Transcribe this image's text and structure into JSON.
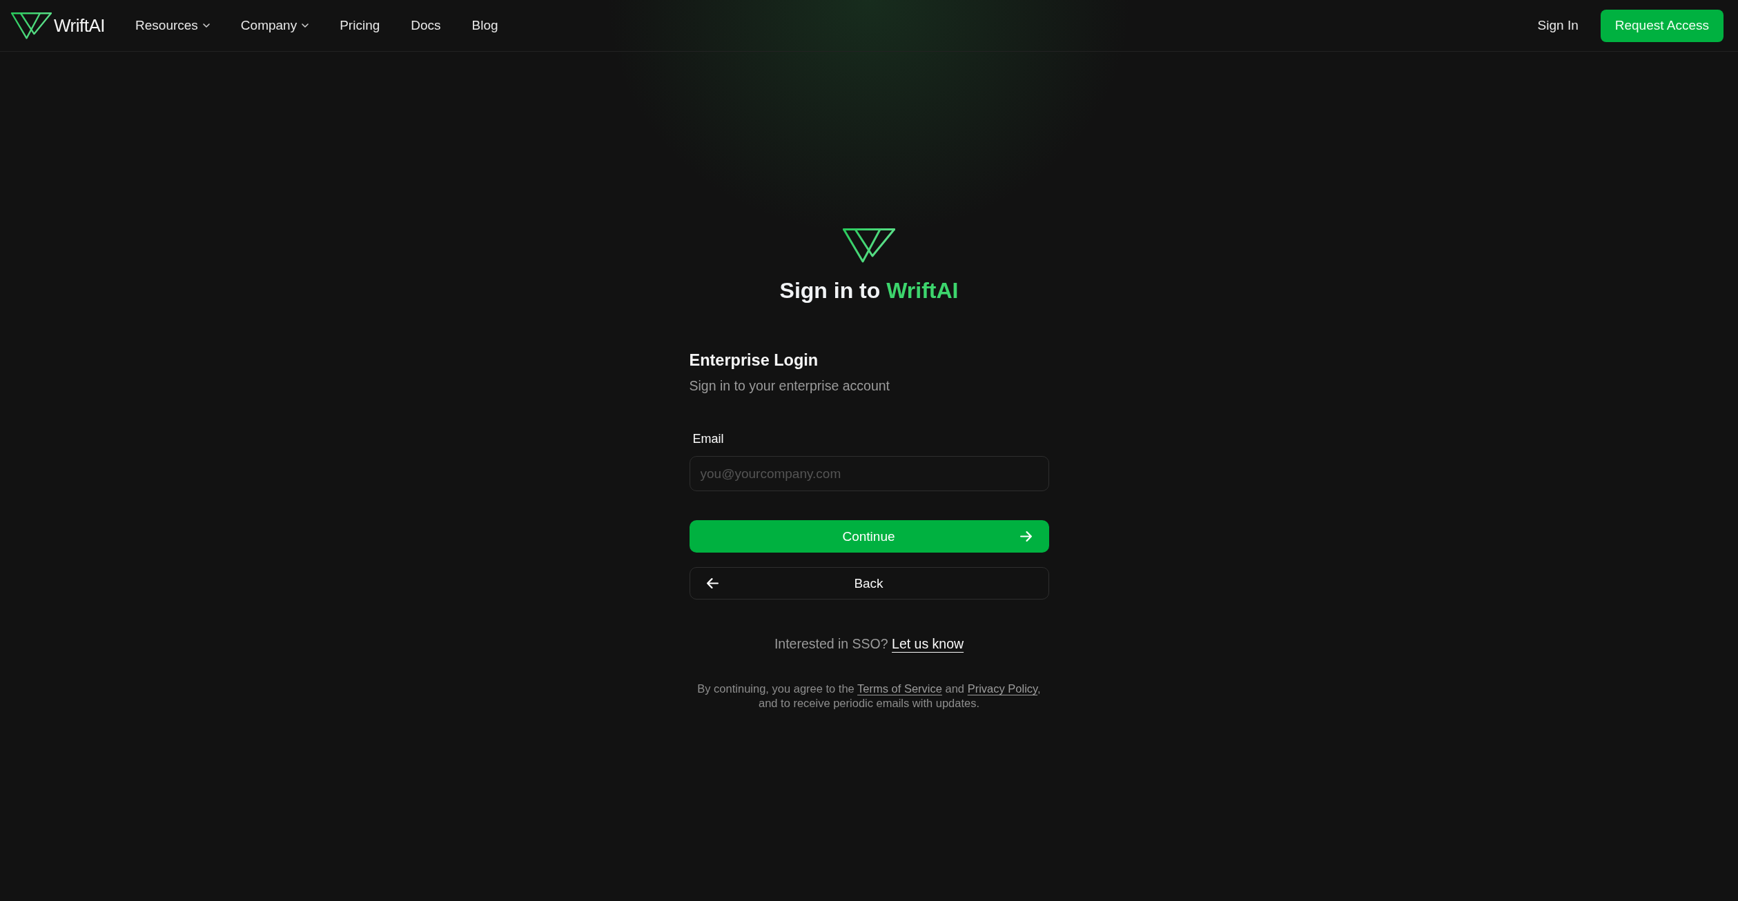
{
  "header": {
    "brand": "WriftAI",
    "nav": [
      {
        "kind": "dropdown",
        "label": "Resources"
      },
      {
        "kind": "dropdown",
        "label": "Company"
      },
      {
        "kind": "link",
        "label": "Pricing"
      },
      {
        "kind": "link",
        "label": "Docs"
      },
      {
        "kind": "link",
        "label": "Blog"
      }
    ],
    "actions": [
      {
        "kind": "link",
        "label": "Sign In"
      },
      {
        "kind": "primary",
        "label": "Request Access"
      }
    ]
  },
  "title": {
    "text": "Sign in to",
    "highlight": "WriftAI"
  },
  "form": {
    "title": "Enterprise Login",
    "subtitle": "Sign in to your enterprise account",
    "fields": [
      {
        "label": "Email",
        "placeholder": "you@yourcompany.com"
      }
    ],
    "buttons": [
      {
        "kind": "primary",
        "label": "Continue"
      },
      {
        "kind": "secondary",
        "label": "Back"
      }
    ]
  },
  "sso": {
    "text": "Interested in SSO?",
    "link": "Let us know"
  },
  "legal": [
    {
      "kind": "text",
      "text": "By continuing, you agree to the "
    },
    {
      "kind": "link",
      "text": "Terms of Service"
    },
    {
      "kind": "text",
      "text": " and "
    },
    {
      "kind": "link",
      "text": "Privacy Policy"
    },
    {
      "kind": "text",
      "text": ", and to receive periodic emails with updates."
    }
  ]
}
